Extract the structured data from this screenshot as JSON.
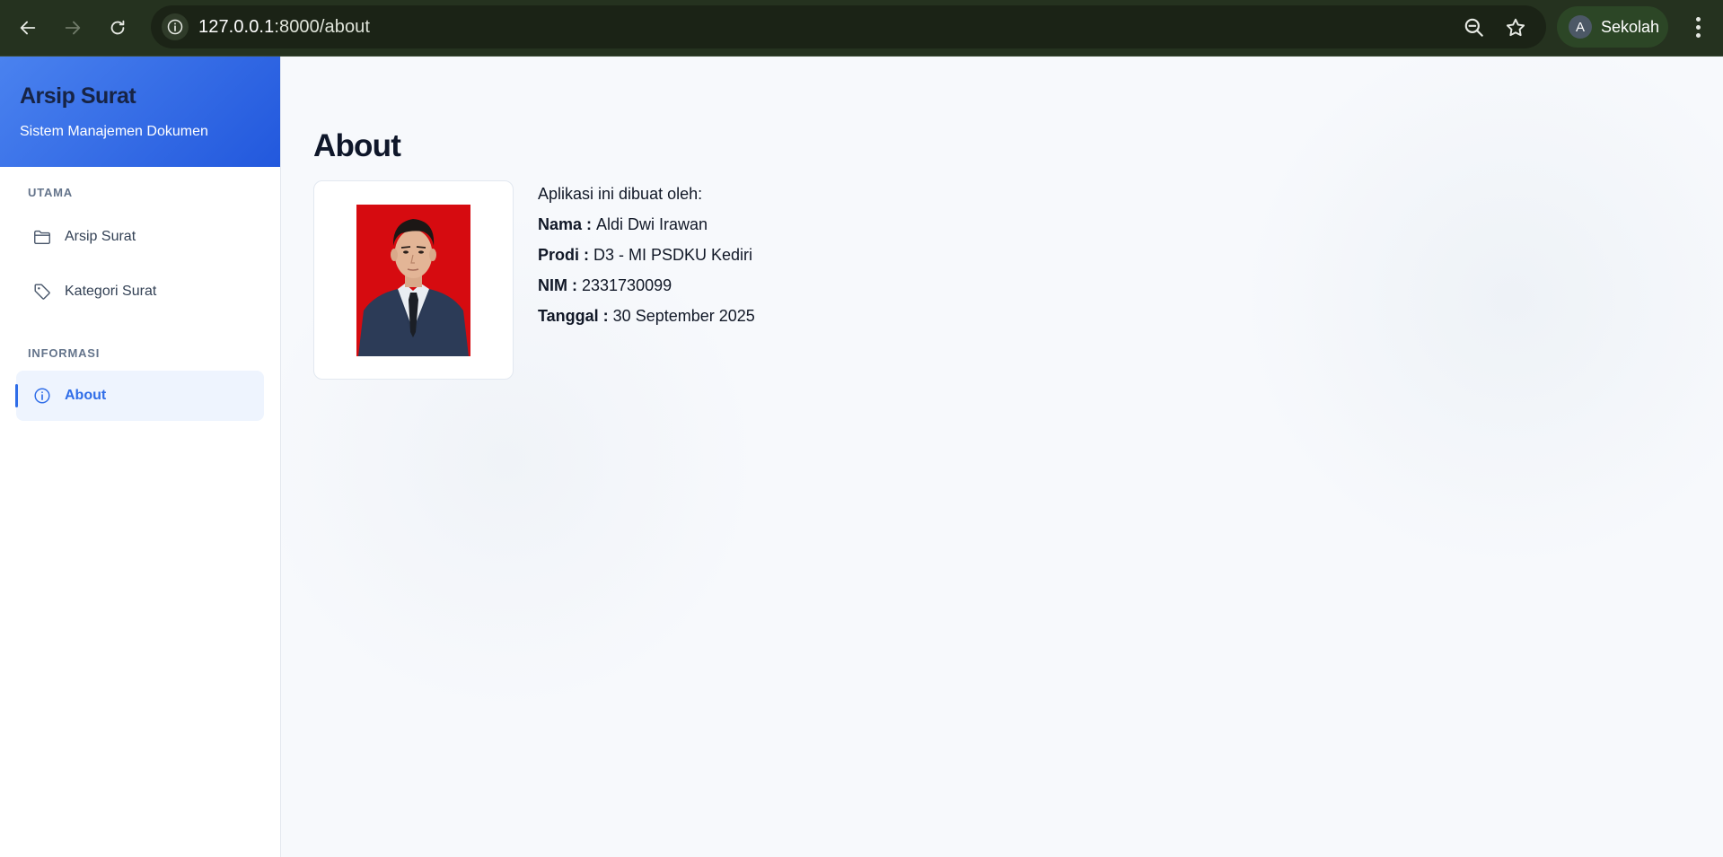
{
  "browser": {
    "url_host": "127.0.0.1",
    "url_path": ":8000/about",
    "profile_initial": "A",
    "profile_name": "Sekolah"
  },
  "sidebar": {
    "brand_title": "Arsip Surat",
    "brand_subtitle": "Sistem Manajemen Dokumen",
    "sections": [
      {
        "label": "UTAMA",
        "items": [
          {
            "label": "Arsip Surat",
            "icon": "folder-icon"
          },
          {
            "label": "Kategori Surat",
            "icon": "tag-icon"
          }
        ]
      },
      {
        "label": "INFORMASI",
        "items": [
          {
            "label": "About",
            "icon": "info-icon",
            "active": true
          }
        ]
      }
    ]
  },
  "main": {
    "title": "About",
    "intro": "Aplikasi ini dibuat oleh:",
    "fields": [
      {
        "label": "Nama",
        "sep": " : ",
        "value": "Aldi Dwi Irawan"
      },
      {
        "label": "Prodi",
        "sep": " : ",
        "value": "D3 - MI PSDKU Kediri"
      },
      {
        "label": "NIM",
        "sep": " : ",
        "value": "2331730099"
      },
      {
        "label": "Tanggal",
        "sep": " : ",
        "value": "30 September 2025"
      }
    ]
  },
  "colors": {
    "accent": "#2f6de8",
    "brand_gradient_start": "#4a82ef",
    "brand_gradient_end": "#2258dd",
    "photo_background": "#d60b10"
  }
}
